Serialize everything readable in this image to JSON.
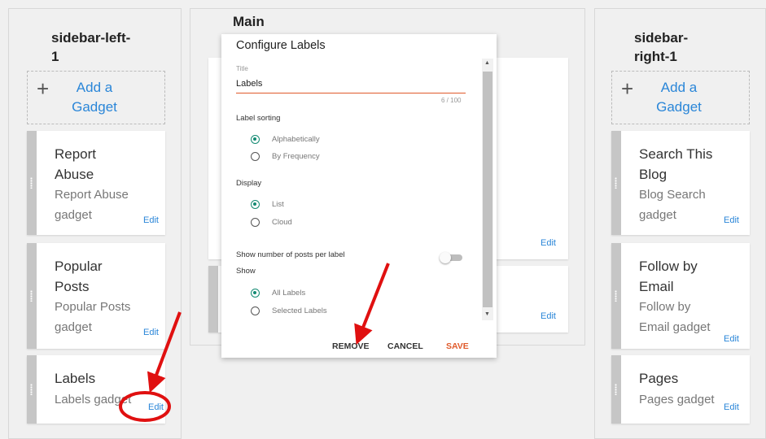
{
  "left": {
    "title_line1": "sidebar-left-",
    "title_line2": "1",
    "add_line1": "Add a",
    "add_line2": "Gadget",
    "cards": [
      {
        "t1": "Report",
        "t2": "Abuse",
        "s1": "Report Abuse",
        "s2": "gadget",
        "edit": "Edit"
      },
      {
        "t1": "Popular",
        "t2": "Posts",
        "s1": "Popular Posts",
        "s2": "gadget",
        "edit": "Edit"
      },
      {
        "t1": "Labels",
        "s1": "Labels gadget",
        "edit": "Edit"
      }
    ]
  },
  "main": {
    "title": "Main",
    "edit1": "Edit",
    "edit2": "Edit"
  },
  "right": {
    "title_line1": "sidebar-",
    "title_line2": "right-1",
    "add_line1": "Add a",
    "add_line2": "Gadget",
    "cards": [
      {
        "t1": "Search This",
        "t2": "Blog",
        "s1": "Blog Search",
        "s2": "gadget",
        "edit": "Edit"
      },
      {
        "t1": "Follow by",
        "t2": "Email",
        "s1": "Follow by",
        "s2": "Email gadget",
        "edit": "Edit"
      },
      {
        "t1": "Pages",
        "s1": "Pages gadget",
        "edit": "Edit"
      }
    ]
  },
  "dialog": {
    "heading": "Configure Labels",
    "title_label": "Title",
    "title_value": "Labels",
    "char_count": "6 / 100",
    "sorting_label": "Label sorting",
    "sort_options": [
      "Alphabetically",
      "By Frequency"
    ],
    "sort_selected": "Alphabetically",
    "display_label": "Display",
    "display_options": [
      "List",
      "Cloud"
    ],
    "display_selected": "List",
    "show_count_label": "Show number of posts per label",
    "show_count_on": false,
    "show_label": "Show",
    "show_options": [
      "All Labels",
      "Selected Labels"
    ],
    "show_selected": "All Labels",
    "remove": "REMOVE",
    "cancel": "CANCEL",
    "save": "SAVE"
  },
  "colors": {
    "accent": "#2a86d8",
    "radio_on": "#138a72",
    "save": "#e05a2b",
    "annotation": "#e01010"
  }
}
